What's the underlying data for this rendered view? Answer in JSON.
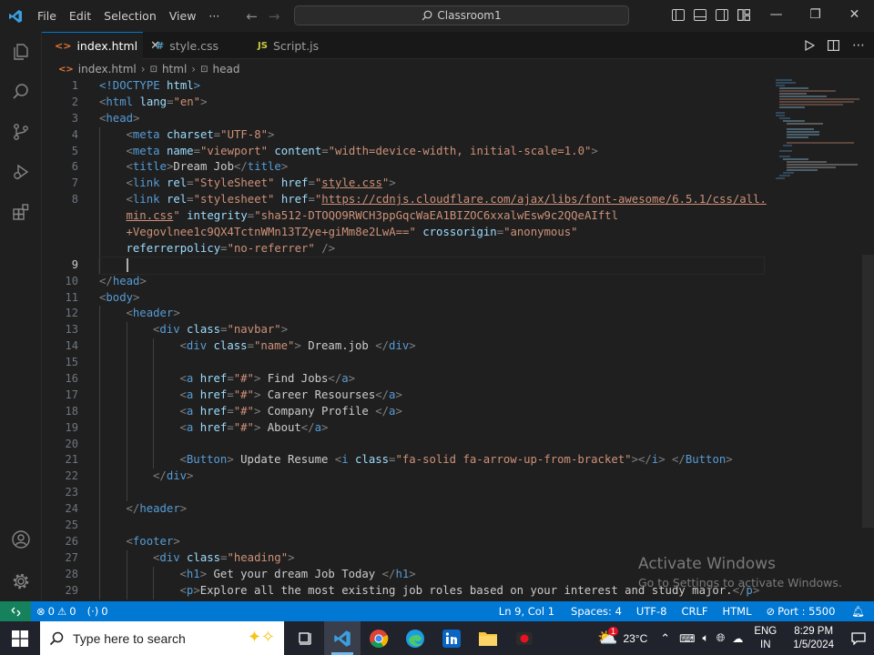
{
  "titlebar": {
    "menu": [
      "File",
      "Edit",
      "Selection",
      "View",
      "···"
    ],
    "search_text": "Classroom1",
    "window_controls": [
      "—",
      "❐",
      "✕"
    ]
  },
  "activity_icons": [
    "explorer-icon",
    "search-icon",
    "source-control-icon",
    "run-debug-icon",
    "extensions-icon",
    "account-icon",
    "settings-icon"
  ],
  "tabs": [
    {
      "label": "index.html",
      "icon": "<>",
      "icon_color": "#e37933",
      "active": true
    },
    {
      "label": "style.css",
      "icon": "#",
      "icon_color": "#519aba",
      "active": false
    },
    {
      "label": "Script.js",
      "icon": "JS",
      "icon_color": "#cbcb41",
      "active": false
    }
  ],
  "breadcrumb": [
    "index.html",
    "html",
    "head"
  ],
  "line_numbers": [
    "1",
    "2",
    "3",
    "4",
    "5",
    "6",
    "7",
    "8",
    "",
    "",
    "",
    "9",
    "10",
    "11",
    "12",
    "13",
    "14",
    "15",
    "16",
    "17",
    "18",
    "19",
    "20",
    "21",
    "22",
    "23",
    "24",
    "25",
    "26",
    "27",
    "28",
    "29"
  ],
  "current_line": "9",
  "statusbar": {
    "errors": "0",
    "warnings": "0",
    "ports": "0",
    "position": "Ln 9, Col 1",
    "spaces": "Spaces: 4",
    "encoding": "UTF-8",
    "eol": "CRLF",
    "language": "HTML",
    "port": "Port : 5500"
  },
  "watermark": {
    "title": "Activate Windows",
    "subtitle": "Go to Settings to activate Windows."
  },
  "taskbar": {
    "search_placeholder": "Type here to search",
    "weather": "23°C",
    "language": "ENG",
    "region": "IN",
    "time": "8:29 PM",
    "date": "1/5/2024",
    "weather_badge": "1"
  },
  "colors": {
    "accent": "#0078d4",
    "remote": "#16825d",
    "tag": "#569cd6",
    "attr": "#9cdcfe",
    "string": "#ce9178"
  }
}
